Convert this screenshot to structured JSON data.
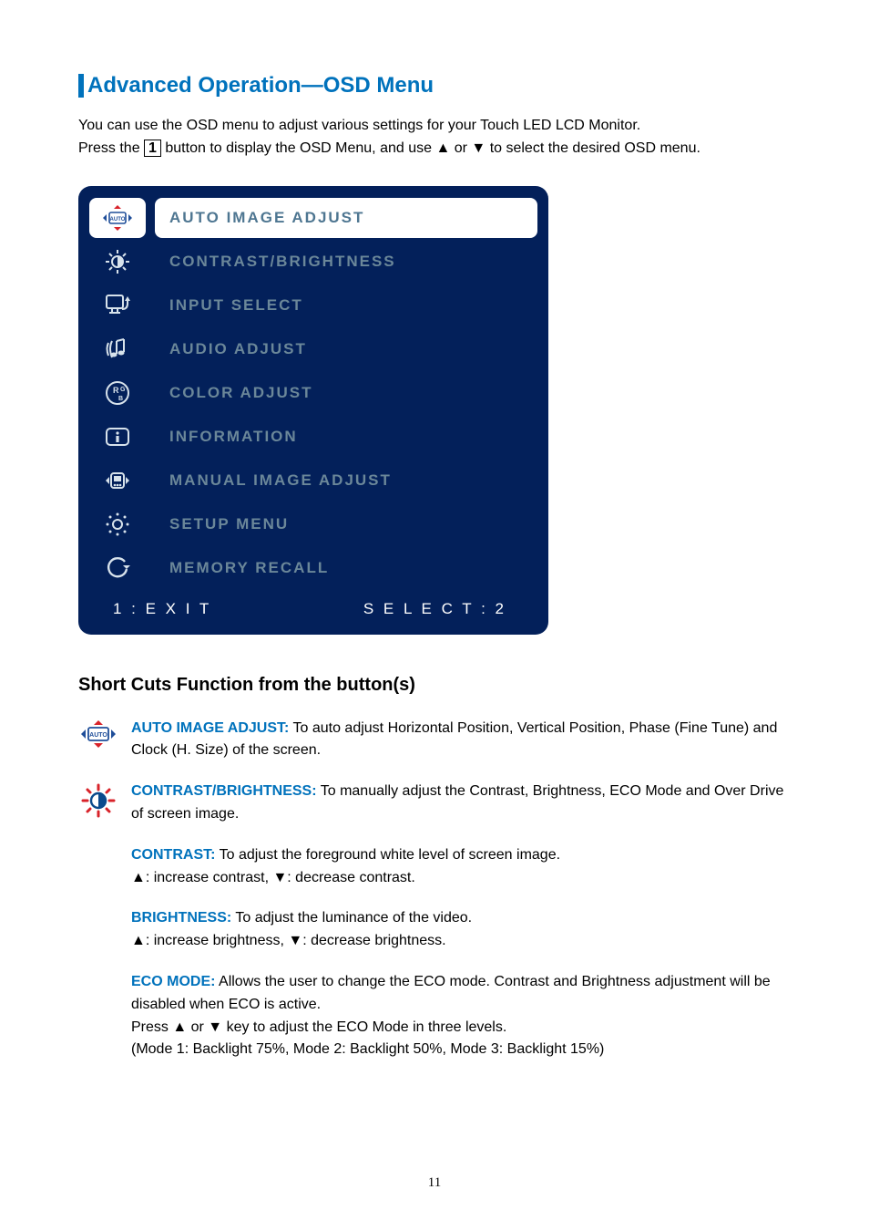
{
  "page_number": "11",
  "heading": "Advanced Operation—OSD Menu",
  "intro_line1": "You can use the OSD menu to adjust various settings for your Touch LED LCD Monitor.",
  "intro_before_box": "Press the ",
  "intro_box": "1",
  "intro_after_box": " button to display the OSD Menu, and use ▲ or ▼ to select the desired OSD menu.",
  "osd_items": [
    {
      "label": "AUTO IMAGE ADJUST",
      "icon": "auto-icon",
      "active": true
    },
    {
      "label": "CONTRAST/BRIGHTNESS",
      "icon": "brightness-icon"
    },
    {
      "label": "INPUT SELECT",
      "icon": "input-icon"
    },
    {
      "label": "AUDIO ADJUST",
      "icon": "audio-icon"
    },
    {
      "label": "COLOR ADJUST",
      "icon": "color-icon"
    },
    {
      "label": "INFORMATION",
      "icon": "info-icon"
    },
    {
      "label": "MANUAL IMAGE ADJUST",
      "icon": "manual-icon"
    },
    {
      "label": "SETUP MENU",
      "icon": "setup-icon"
    },
    {
      "label": "MEMORY RECALL",
      "icon": "recall-icon"
    }
  ],
  "osd_footer_left": "1 : E X I T",
  "osd_footer_right": "S E L E C T : 2",
  "subheading": "Short Cuts Function from the button(s)",
  "auto_label": "AUTO IMAGE ADJUST:",
  "auto_text": " To auto adjust Horizontal Position, Vertical Position, Phase (Fine Tune) and Clock (H. Size) of the screen.",
  "cb_label": "CONTRAST/BRIGHTNESS:",
  "cb_text": " To manually adjust the Contrast, Brightness, ECO Mode and Over Drive of screen image.",
  "contrast_label": "CONTRAST:",
  "contrast_text": " To adjust the foreground white level of screen image.",
  "contrast_keys": "▲: increase contrast, ▼: decrease contrast.",
  "brightness_label": "BRIGHTNESS:",
  "brightness_text": " To adjust the luminance of the video.",
  "brightness_keys": "▲: increase brightness, ▼: decrease brightness.",
  "eco_label": "ECO MODE:",
  "eco_text1": " Allows the user to change the ECO mode. Contrast and Brightness adjustment will be disabled when ECO is active.",
  "eco_text2": "Press ▲ or ▼ key to adjust the ECO Mode in three levels.",
  "eco_text3": "(Mode 1: Backlight 75%, Mode 2: Backlight 50%, Mode 3: Backlight 15%)"
}
